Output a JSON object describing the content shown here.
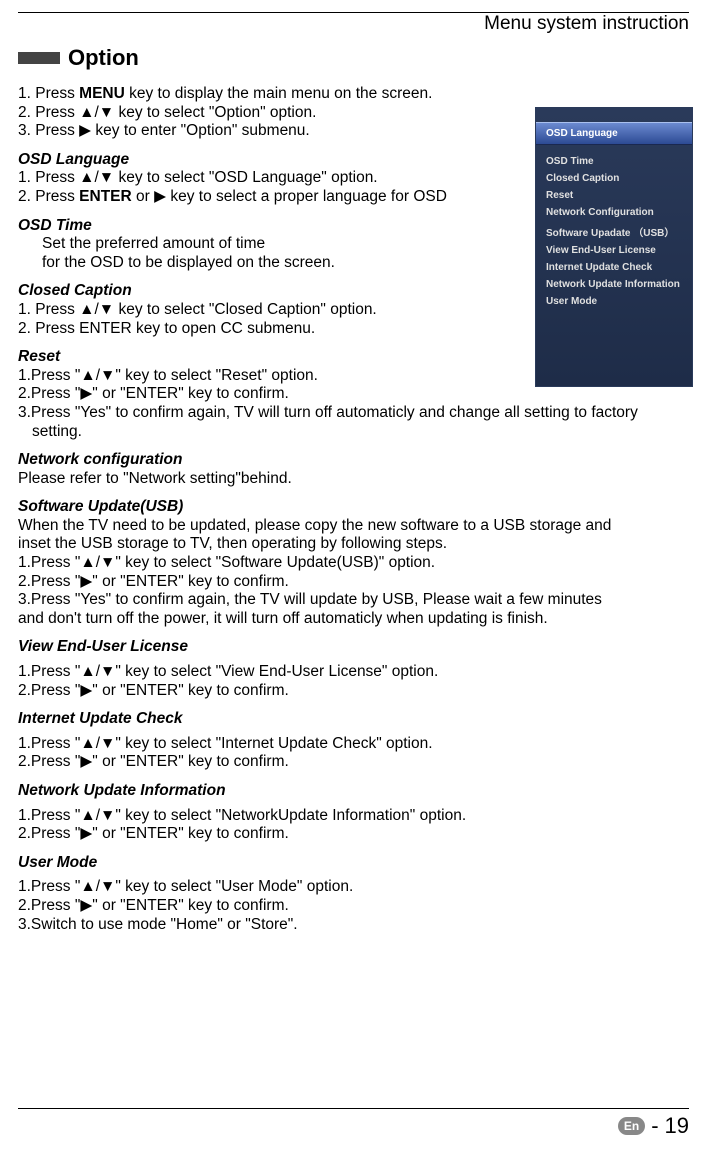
{
  "header": {
    "title": "Menu system instruction"
  },
  "section": {
    "title": "Option"
  },
  "intro": {
    "l1a": "1. Press ",
    "l1b": "MENU",
    "l1c": " key to display the main menu on the screen.",
    "l2": "2. Press ▲/▼ key to select \"Option\" option.",
    "l3": "3. Press ▶ key to enter \"Option\" submenu."
  },
  "osdLanguage": {
    "h": "OSD Language",
    "l1": "1. Press ▲/▼ key to select \"OSD Language\" option.",
    "l2a": "2. Press ",
    "l2b": "ENTER",
    "l2c": " or ▶ key to select a proper language for OSD"
  },
  "osdTime": {
    "h": "OSD Time",
    "l1": "Set the preferred amount of time",
    "l2": "for the OSD to be displayed on the screen."
  },
  "closedCaption": {
    "h": "Closed Caption",
    "l1": "1. Press ▲/▼ key to select \"Closed Caption\" option.",
    "l2": "2. Press  ENTER  key  to  open  CC  submenu."
  },
  "reset": {
    "h": "Reset",
    "l1": "1.Press \"▲/▼\" key to select \"Reset\" option.",
    "l2": "2.Press \"▶\" or \"ENTER\" key to confirm.",
    "l3": "3.Press \"Yes\" to confirm again, TV will turn off automaticly and change all setting to factory",
    "l4": "setting."
  },
  "networkConf": {
    "h": "Network configuration",
    "l1": "Please refer to \"Network setting\"behind."
  },
  "softwareUpdate": {
    "h": "Software Update(USB)",
    "l1": "When the TV need to be updated, please copy the new software to a USB storage and",
    "l2": "inset the USB storage to TV, then operating by following steps.",
    "l3": "1.Press \"▲/▼\" key to select \"Software Update(USB)\" option.",
    "l4": "2.Press \"▶\" or \"ENTER\" key to confirm.",
    "l5": "3.Press \"Yes\" to confirm again, the TV will update by USB, Please wait a few minutes",
    "l6": "and don't turn off the power, it will turn off automaticly when updating is finish."
  },
  "viewLicense": {
    "h": "View End-User License",
    "l1": "1.Press \"▲/▼\" key to select \"View End-User License\" option.",
    "l2": "2.Press \"▶\" or \"ENTER\" key to confirm."
  },
  "internetUpdate": {
    "h": "Internet Update Check",
    "l1": "1.Press \"▲/▼\" key to select \"Internet Update Check\" option.",
    "l2": "2.Press \"▶\" or \"ENTER\" key to confirm."
  },
  "networkUpdate": {
    "h": "Network Update Information",
    "l1": "1.Press \"▲/▼\" key to select \"NetworkUpdate Information\" option.",
    "l2": "2.Press \"▶\" or \"ENTER\" key to confirm."
  },
  "userMode": {
    "h": "User Mode",
    "l1": "1.Press \"▲/▼\" key to select \"User Mode\" option.",
    "l2": "2.Press \"▶\" or \"ENTER\" key to confirm.",
    "l3": "3.Switch to use mode \"Home\" or \"Store\"."
  },
  "osdMenu": {
    "items": [
      "OSD Language",
      "OSD Time",
      "Closed Caption",
      "Reset",
      "Network Configuration",
      "Software Upadate （USB）",
      "View End-User License",
      "Internet Update Check",
      "Network Update Information",
      "User Mode"
    ]
  },
  "footer": {
    "lang": "En",
    "page": "19"
  }
}
